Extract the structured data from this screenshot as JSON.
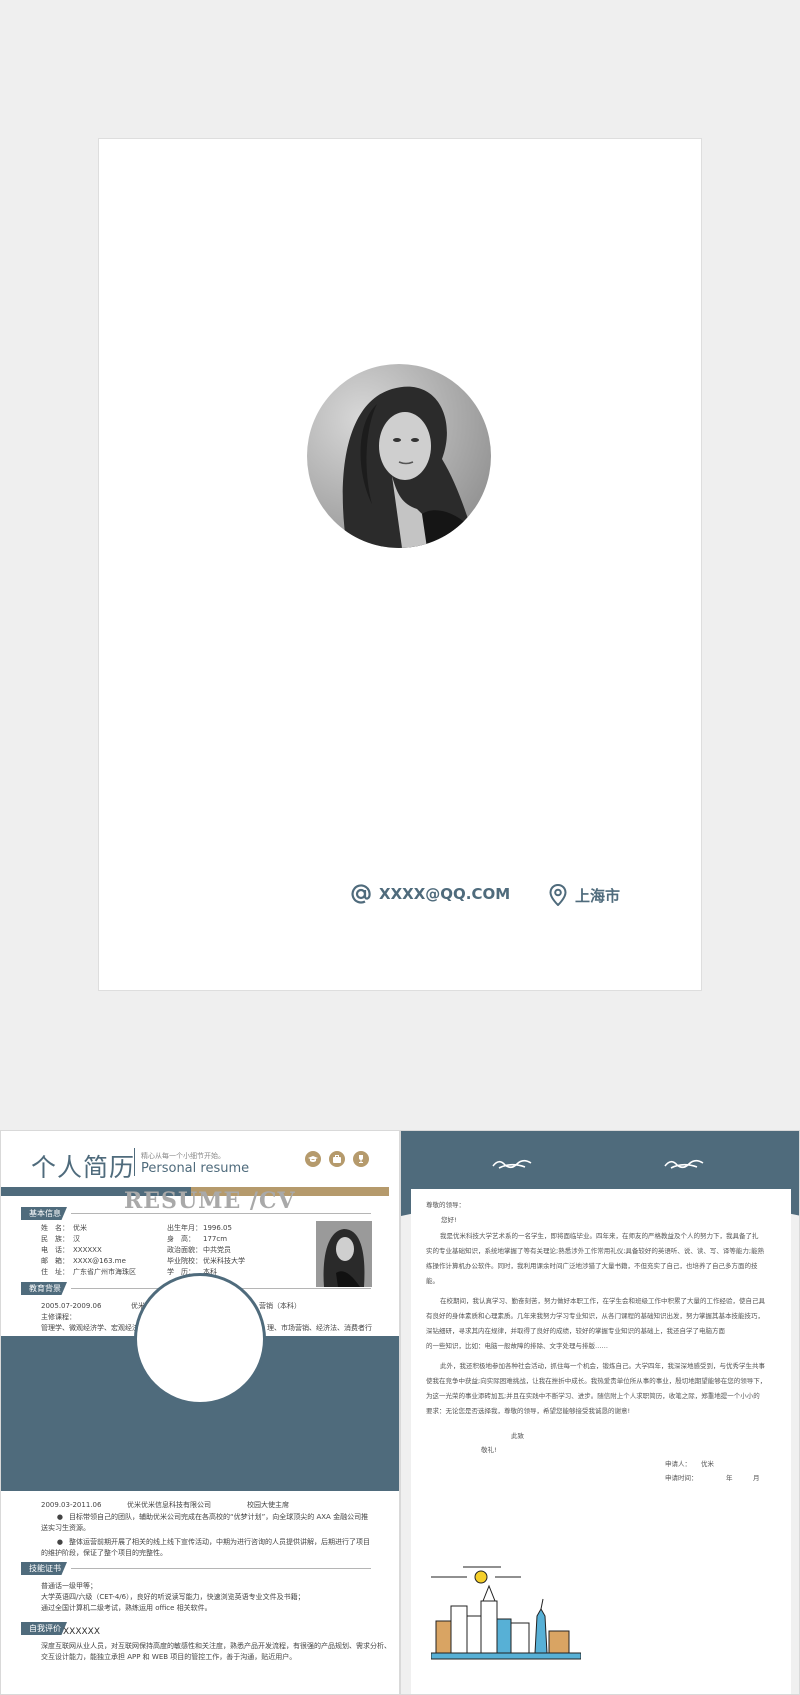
{
  "cover": {
    "email": "XXXX@QQ.COM",
    "location": "上海市"
  },
  "resume": {
    "title": "个人简历",
    "slogan": "精心从每一个小细节开始。",
    "subtitle": "Personal resume",
    "watermark": "RESUME /CV",
    "sections": {
      "basic": "基本信息",
      "education": "教育背景",
      "skills": "技能证书",
      "self": "自我评价"
    },
    "basic_left": [
      {
        "k": "姓　名：",
        "v": "优米"
      },
      {
        "k": "民　族：",
        "v": "汉"
      },
      {
        "k": "电　话：",
        "v": "XXXXXX"
      },
      {
        "k": "邮　箱：",
        "v": "XXXX@163.me"
      },
      {
        "k": "住　址：",
        "v": "广东省广州市海珠区"
      }
    ],
    "basic_right": [
      {
        "k": "出生年月：",
        "v": "1996.05"
      },
      {
        "k": "身　高：",
        "v": "177cm"
      },
      {
        "k": "政治面貌：",
        "v": "中共党员"
      },
      {
        "k": "毕业院校：",
        "v": "优米科技大学"
      },
      {
        "k": "学　历：",
        "v": "本科"
      }
    ],
    "edu_period": "2005.07-2009.06",
    "edu_school": "优米",
    "edu_major": "营销（本科）",
    "edu_course_label": "主修课程：",
    "edu_course": "管理学、微观经济学、宏观经济",
    "edu_course_tail": "理、市场营销、经济法、消费者行",
    "work_period": "2009.03-2011.06",
    "work_company": "优米优米信息科技有限公司",
    "work_role": "校园大使主席",
    "work_bullet1": "目标带领自己的团队，辅助优米公司完成在各高校的“优梦计划”，向全球顶尖的 AXA 金融公司推送实习生资源。",
    "work_bullet2": "整体运营前期开展了相关的线上线下宣传活动，中期为进行咨询的人员提供讲解，后期进行了项目的维护阶段，保证了整个项目的完整性。",
    "skills_lines": [
      "普通话一级甲等；",
      "大学英语四/六级（CET-4/6），良好的听说读写能力，快速浏览英语专业文件及书籍；",
      "通过全国计算机二级考试，熟练运用 office 相关软件。"
    ],
    "self_mark": "XXXXXX",
    "self_lines": [
      "深度互联网从业人员，对互联网保持高度的敏感性和关注度，熟悉产品开发流程，有很强的产品规划、需求分析、",
      "交互设计能力，能独立承担 APP 和 WEB 项目的管控工作，善于沟通，贴近用户。"
    ]
  },
  "letter": {
    "greeting": "尊敬的领导：",
    "hello": "您好!",
    "para1": [
      "我是优米科技大学艺术系的一名学生，即将面临毕业。四年来，在师友的严格教益及个人的努力下，我具备了扎",
      "实的专业基础知识，系统地掌握了等有关理论;熟悉涉外工作常用礼仪;具备较好的英语听、说、读、写、译等能力;能熟",
      "练操作计算机办公软件。同时，我利用课余时间广泛地涉猎了大量书籍，不但充实了自己，也培养了自己多方面的技",
      "能。"
    ],
    "para2": [
      "在校期间，我认真学习、勤奋刻苦，努力做好本职工作，在学生会和班级工作中积累了大量的工作经验，使自己具",
      "有良好的身体素质和心理素质。几年来我努力学习专业知识，从各门课程的基础知识出发，努力掌握其基本技能技巧，",
      "深钻细研，寻求其内在规律，并取得了良好的成绩，较好的掌握专业知识的基础上，我还自学了电脑方面",
      "的一些知识，比如：电脑一般故障的排除、文字处理与排版……"
    ],
    "para3": [
      "此外，我还积极地参加各种社会活动，抓住每一个机会，锻炼自己。大学四年，我深深地感受到，与优秀学生共事",
      "使我在竞争中获益;向实际困难挑战，让我在挫折中成长。我热爱贵单位所从事的事业，殷切地期望能够在您的领导下，",
      "为这一光荣的事业添砖加瓦;并且在实践中不断学习、进步。随信附上个人求职简历，收笔之际，郑重地提一个小小的",
      "要求：无论您是否选择我，尊敬的领导，希望您能够接受我诚恳的谢意!"
    ],
    "closing1": "此致",
    "closing2": "敬礼!",
    "applicant_label": "申请人：",
    "applicant": "优米",
    "date_label": "申请时间：",
    "year": "年",
    "month": "月"
  }
}
